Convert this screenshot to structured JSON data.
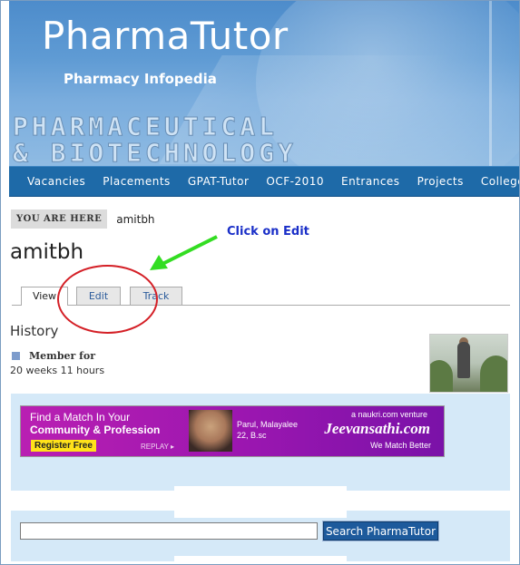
{
  "header": {
    "site_name": "PharmaTutor",
    "slogan": "Pharmacy Infopedia",
    "banner_line1": "PHARMACEUTICAL",
    "banner_line2": "& BIOTECHNOLOGY"
  },
  "nav": {
    "items": [
      "Vacancies",
      "Placements",
      "GPAT-Tutor",
      "OCF-2010",
      "Entrances",
      "Projects",
      "Colleges"
    ]
  },
  "breadcrumb": {
    "label": "YOU ARE HERE",
    "current": "amitbh"
  },
  "page": {
    "title": "amitbh",
    "annotation": "Click on Edit"
  },
  "tabs": [
    {
      "label": "View",
      "active": true
    },
    {
      "label": "Edit",
      "active": false
    },
    {
      "label": "Track",
      "active": false
    }
  ],
  "profile": {
    "section_title": "History",
    "member_label": "Member for",
    "member_value": "20 weeks 11 hours"
  },
  "ad": {
    "line1": "Find a Match In Your",
    "line2": "Community & Profession",
    "button": "Register Free",
    "replay": "REPLAY ▸",
    "person_name": "Parul, Malayalee",
    "person_detail": "22, B.sc",
    "venture": "a naukri.com venture",
    "brand": "Jeevansathi.com",
    "tagline": "We Match Better"
  },
  "search": {
    "placeholder": "",
    "button_label": "Search PharmaTutor"
  },
  "colors": {
    "nav_bg": "#1e6aa8",
    "annotation_text": "#1a2fc8",
    "annotation_arrow": "#33dd22",
    "annotation_circle": "#d41f26",
    "panel_bg": "#d5e9f8"
  }
}
